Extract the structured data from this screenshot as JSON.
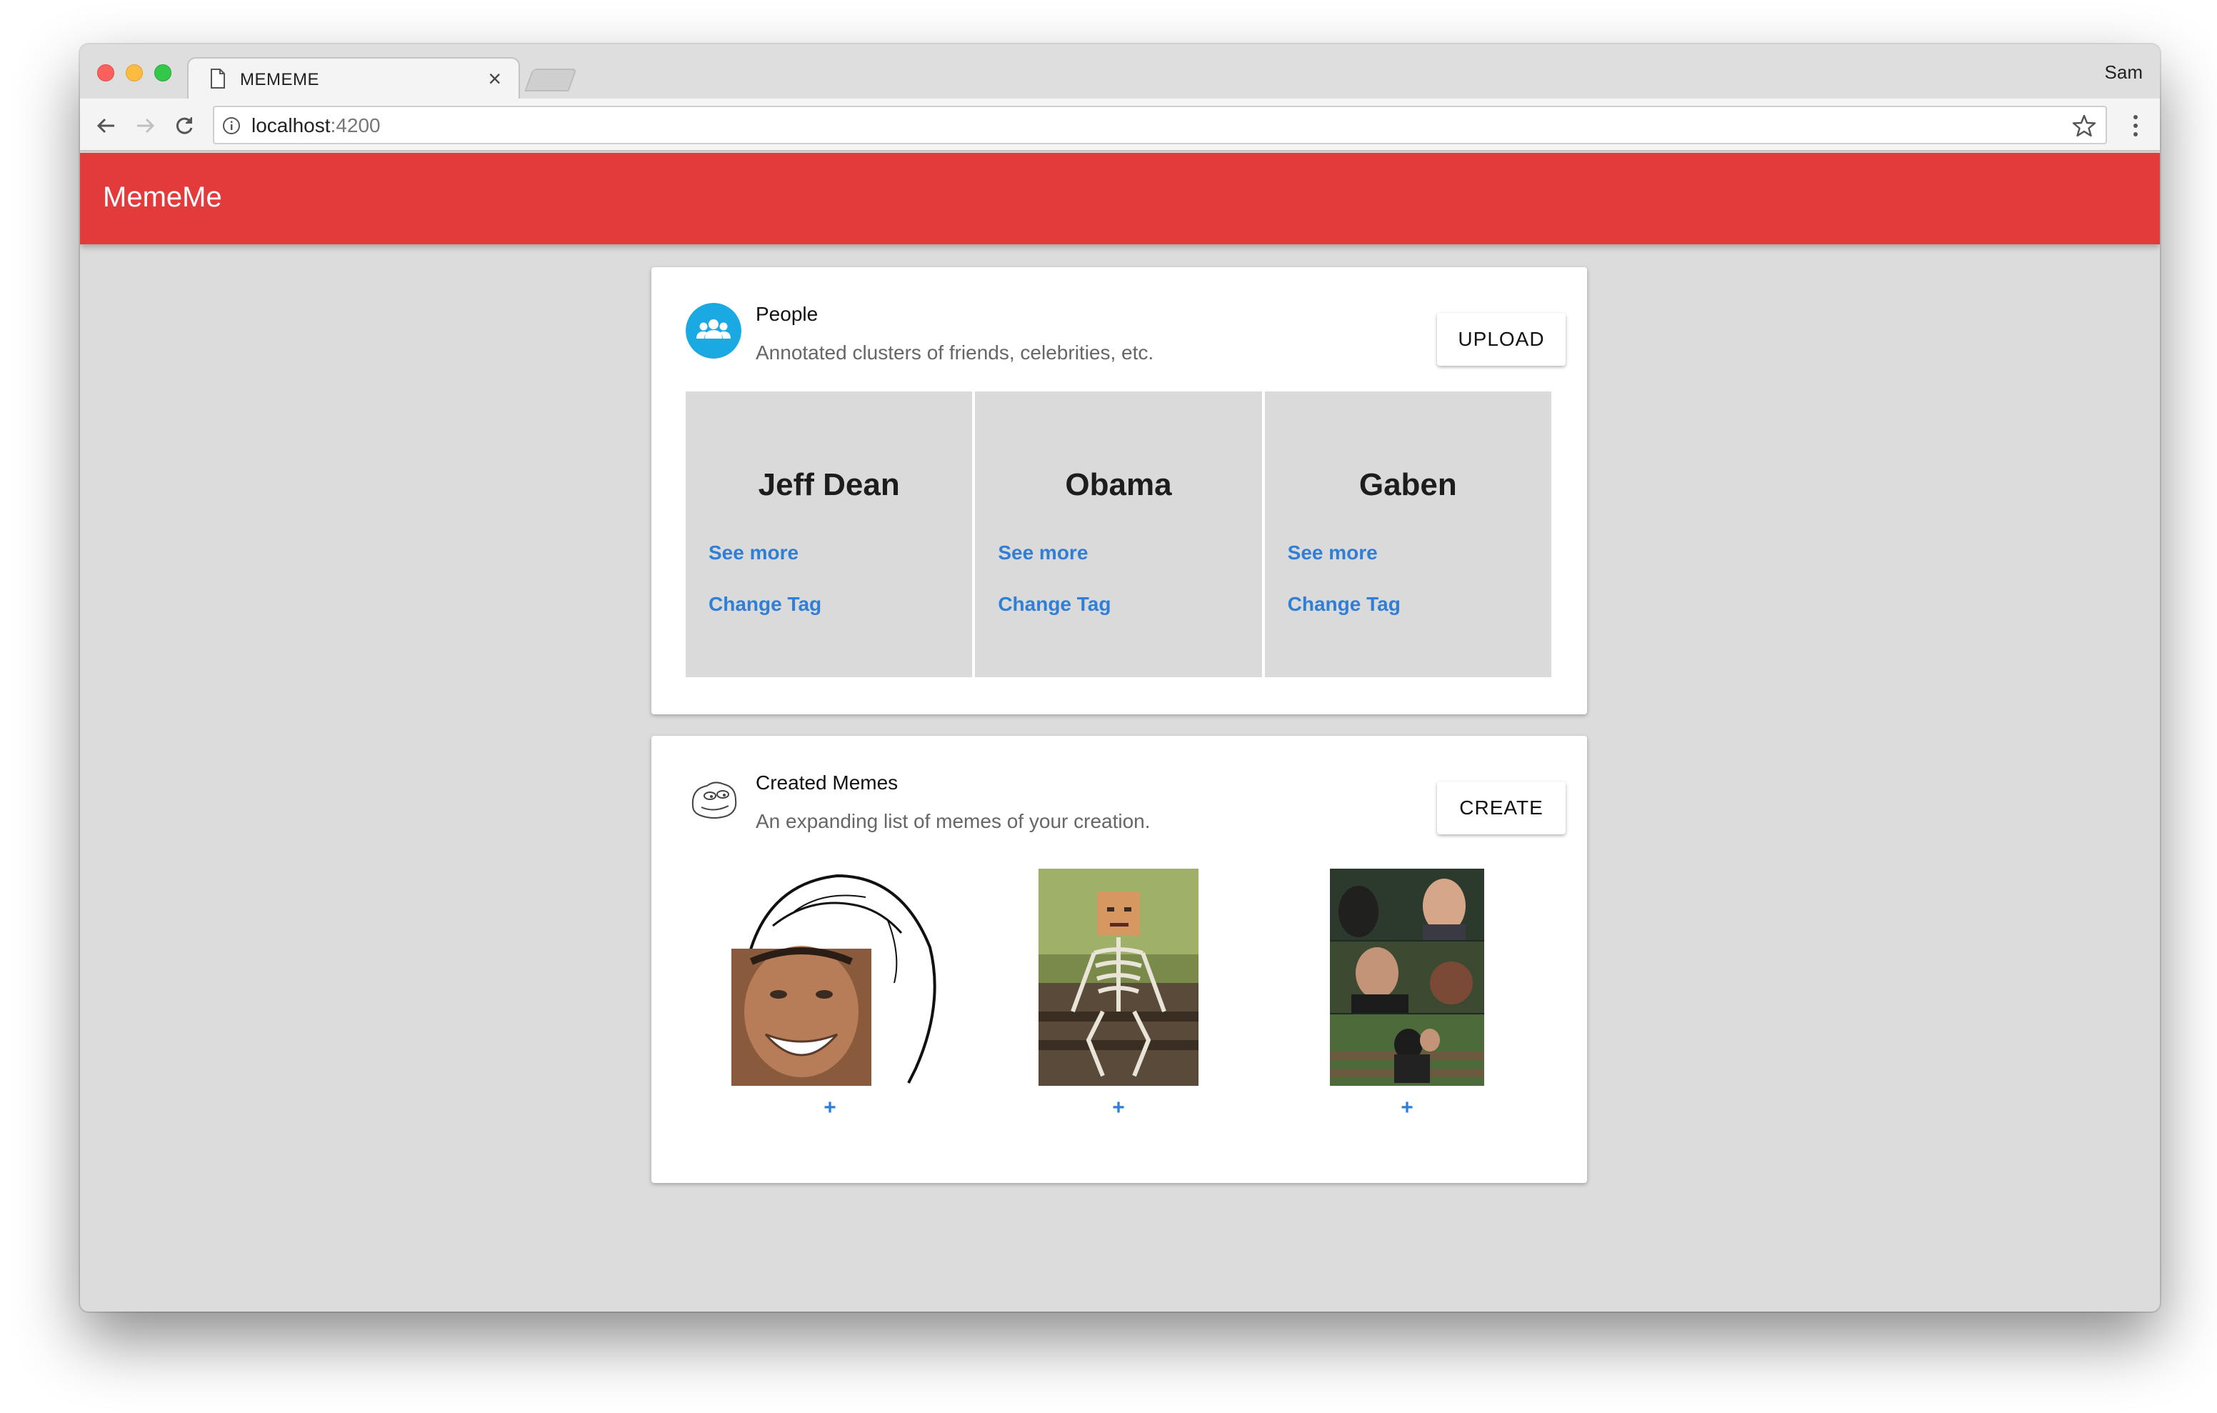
{
  "browser": {
    "tab_title": "MEMEME",
    "tab_close": "×",
    "profile_name": "Sam",
    "url_host": "localhost",
    "url_port": ":4200"
  },
  "app": {
    "title": "MemeMe",
    "brand_color": "#e33b3b",
    "link_color": "#2f7fd8"
  },
  "people_card": {
    "icon": "people-group-icon",
    "title": "People",
    "subtitle": "Annotated clusters of friends, celebrities, etc.",
    "action_label": "UPLOAD",
    "people": [
      {
        "name": "Jeff Dean",
        "see_more": "See more",
        "change_tag": "Change Tag"
      },
      {
        "name": "Obama",
        "see_more": "See more",
        "change_tag": "Change Tag"
      },
      {
        "name": "Gaben",
        "see_more": "See more",
        "change_tag": "Change Tag"
      }
    ]
  },
  "memes_card": {
    "icon": "pepe-face-icon",
    "title": "Created Memes",
    "subtitle": "An expanding list of memes of your creation.",
    "action_label": "CREATE",
    "memes": [
      {
        "image": "rage-face-meme",
        "add_label": "+"
      },
      {
        "image": "skeleton-bench-meme",
        "add_label": "+"
      },
      {
        "image": "three-panel-meme",
        "add_label": "+"
      }
    ]
  }
}
